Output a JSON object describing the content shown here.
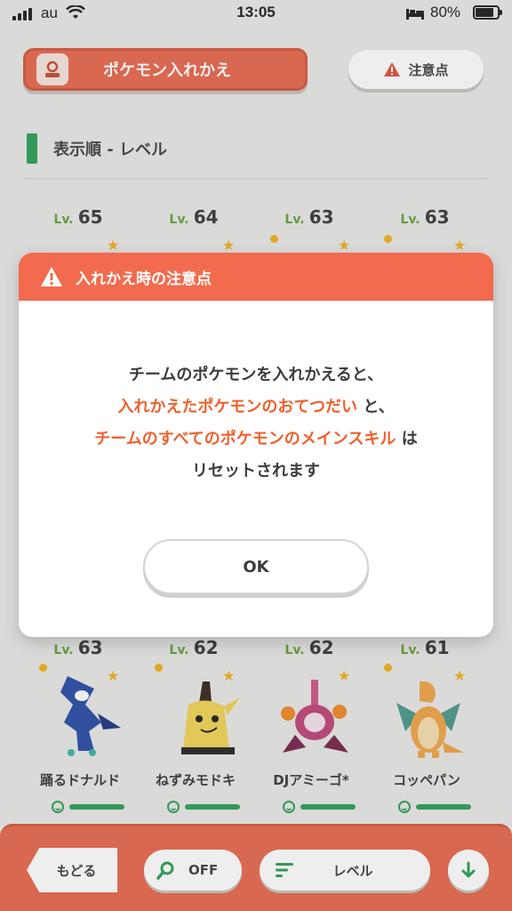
{
  "status_bar": {
    "carrier": "au",
    "time": "13:05",
    "battery": "80%"
  },
  "header": {
    "swap_label": "ポケモン入れかえ",
    "notice_label": "注意点"
  },
  "section": {
    "title": "表示順 - レベル"
  },
  "top_levels": [
    {
      "prefix": "Lv.",
      "value": "65"
    },
    {
      "prefix": "Lv.",
      "value": "64"
    },
    {
      "prefix": "Lv.",
      "value": "63"
    },
    {
      "prefix": "Lv.",
      "value": "63"
    }
  ],
  "bottom_row": [
    {
      "prefix": "Lv.",
      "value": "63",
      "name": "踊るドナルド"
    },
    {
      "prefix": "Lv.",
      "value": "62",
      "name": "ねずみモドキ"
    },
    {
      "prefix": "Lv.",
      "value": "62",
      "name": "DJアミーゴ*"
    },
    {
      "prefix": "Lv.",
      "value": "61",
      "name": "コッペパン"
    }
  ],
  "toolbar": {
    "back_label": "もどる",
    "filter_label": "OFF",
    "sort_label": "レベル"
  },
  "modal": {
    "title": "入れかえ時の注意点",
    "line1": "チームのポケモンを入れかえると、",
    "line2_highlight": "入れかえたポケモンのおてつだい",
    "line2_rest": " と、",
    "line3_highlight": "チームのすべてのポケモンのメインスキル",
    "line3_rest": " は",
    "line4": "リセットされます",
    "ok_label": "OK"
  },
  "colors": {
    "accent": "#e86a50",
    "modal_header": "#f26b4e",
    "highlight": "#f0602c",
    "green": "#2fa05a",
    "star": "#f2b21e"
  }
}
